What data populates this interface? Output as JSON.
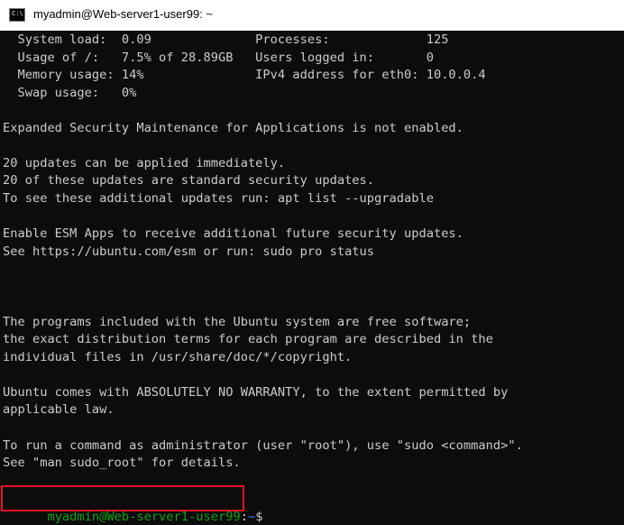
{
  "window": {
    "title": "myadmin@Web-server1-user99: ~",
    "icon": "command-prompt-icon",
    "icon_text": "C:\\"
  },
  "terminal": {
    "lines": [
      "  System load:  0.09              Processes:             125",
      "  Usage of /:   7.5% of 28.89GB   Users logged in:       0",
      "  Memory usage: 14%               IPv4 address for eth0: 10.0.0.4",
      "  Swap usage:   0%",
      "",
      "Expanded Security Maintenance for Applications is not enabled.",
      "",
      "20 updates can be applied immediately.",
      "20 of these updates are standard security updates.",
      "To see these additional updates run: apt list --upgradable",
      "",
      "Enable ESM Apps to receive additional future security updates.",
      "See https://ubuntu.com/esm or run: sudo pro status",
      "",
      "",
      "",
      "The programs included with the Ubuntu system are free software;",
      "the exact distribution terms for each program are described in the",
      "individual files in /usr/share/doc/*/copyright.",
      "",
      "Ubuntu comes with ABSOLUTELY NO WARRANTY, to the extent permitted by",
      "applicable law.",
      "",
      "To run a command as administrator (user \"root\"), use \"sudo <command>\".",
      "See \"man sudo_root\" for details."
    ],
    "prompt": {
      "user_host": "myadmin@Web-server1-user99",
      "colon": ":",
      "path": "~",
      "symbol": "$"
    }
  },
  "colors": {
    "terminal_bg": "#0c0c0c",
    "terminal_fg": "#cccccc",
    "prompt_user": "#13a10e",
    "prompt_path": "#3b78ff",
    "highlight_border": "#e81123"
  }
}
